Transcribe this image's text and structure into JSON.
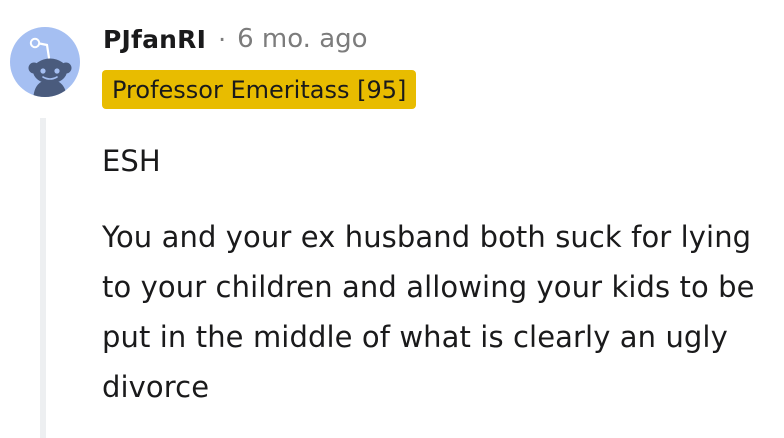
{
  "comment": {
    "author": "PJfanRI",
    "separator": "·",
    "timestamp": "6 mo. ago",
    "flair": "Professor Emeritass [95]",
    "avatar_icon": "snoo-default-avatar",
    "avatar_color": "#a5bff2",
    "flair_color": "#e8bc00",
    "paragraphs": [
      "ESH",
      "You and your ex husband both suck for lying to your children and allowing your kids to be put in the middle of what is clearly an ugly divorce"
    ]
  }
}
